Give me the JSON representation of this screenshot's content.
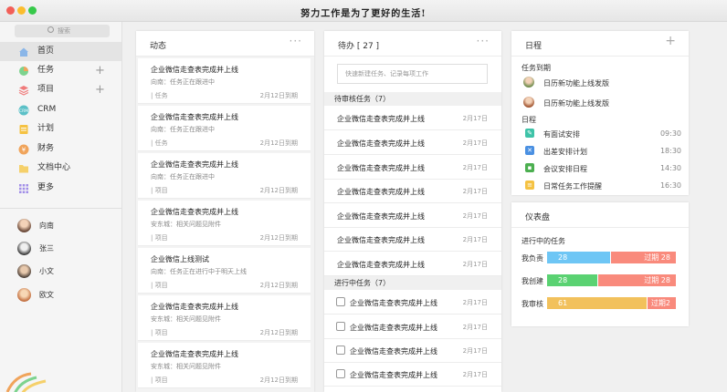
{
  "window": {
    "title": "努力工作是为了更好的生活!"
  },
  "search": {
    "placeholder": "搜索"
  },
  "sidebar": {
    "nav": [
      {
        "label": "首页",
        "icon": "home-icon"
      },
      {
        "label": "任务",
        "icon": "task-icon"
      },
      {
        "label": "项目",
        "icon": "project-icon"
      },
      {
        "label": "CRM",
        "icon": "crm-icon"
      },
      {
        "label": "计划",
        "icon": "plan-icon"
      },
      {
        "label": "财务",
        "icon": "finance-icon"
      },
      {
        "label": "文档中心",
        "icon": "document-icon"
      },
      {
        "label": "更多",
        "icon": "more-grid-icon"
      }
    ],
    "people": [
      "向南",
      "张三",
      "小文",
      "欧文"
    ]
  },
  "feed": {
    "title": "动态",
    "items": [
      {
        "title": "企业微信走查表完成并上线",
        "desc": "向南：任务正在跟进中",
        "tag": "任务",
        "date": "2月12日到期"
      },
      {
        "title": "企业微信走查表完成并上线",
        "desc": "向南：任务正在跟进中",
        "tag": "任务",
        "date": "2月12日到期"
      },
      {
        "title": "企业微信走查表完成并上线",
        "desc": "向南：任务正在跟进中",
        "tag": "项目",
        "date": "2月12日到期"
      },
      {
        "title": "企业微信走查表完成并上线",
        "desc": "安东城：相关问题见附件",
        "tag": "项目",
        "date": "2月12日到期"
      },
      {
        "title": "企业微信上线测试",
        "desc": "向南：任务正在进行中于明天上线",
        "tag": "项目",
        "date": "2月12日到期"
      },
      {
        "title": "企业微信走查表完成并上线",
        "desc": "安东城：相关问题见附件",
        "tag": "项目",
        "date": "2月12日到期"
      },
      {
        "title": "企业微信走查表完成并上线",
        "desc": "安东城：相关问题见附件",
        "tag": "项目",
        "date": "2月12日到期"
      }
    ]
  },
  "todo": {
    "title": "待办 [ 27 ]",
    "quick_placeholder": "快速新建任务、记录每项工作",
    "pending_header": "待审核任务（7）",
    "pending": [
      {
        "title": "企业微信走查表完成并上线",
        "date": "2月17日"
      },
      {
        "title": "企业微信走查表完成并上线",
        "date": "2月17日"
      },
      {
        "title": "企业微信走查表完成并上线",
        "date": "2月17日"
      },
      {
        "title": "企业微信走查表完成并上线",
        "date": "2月17日"
      },
      {
        "title": "企业微信走查表完成并上线",
        "date": "2月17日"
      },
      {
        "title": "企业微信走查表完成并上线",
        "date": "2月17日"
      },
      {
        "title": "企业微信走查表完成并上线",
        "date": "2月17日"
      }
    ],
    "progress_header": "进行中任务（7）",
    "progress": [
      {
        "title": "企业微信走查表完成并上线",
        "date": "2月17日"
      },
      {
        "title": "企业微信走查表完成并上线",
        "date": "2月17日"
      },
      {
        "title": "企业微信走查表完成并上线",
        "date": "2月17日"
      },
      {
        "title": "企业微信走查表完成并上线",
        "date": "2月17日"
      }
    ]
  },
  "schedule": {
    "title": "日程",
    "due_label": "任务到期",
    "due": [
      {
        "title": "日历新功能上线发版"
      },
      {
        "title": "日历新功能上线发版"
      }
    ],
    "cal_label": "日程",
    "events": [
      {
        "title": "有面试安排",
        "time": "09:30",
        "icon": "interview-icon",
        "color": "#3ec3a8"
      },
      {
        "title": "出差安排计划",
        "time": "18:30",
        "icon": "travel-icon",
        "color": "#4a90e2"
      },
      {
        "title": "会议安排日程",
        "time": "14:30",
        "icon": "meeting-icon",
        "color": "#4caf50"
      },
      {
        "title": "日常任务工作提醒",
        "time": "16:30",
        "icon": "reminder-icon",
        "color": "#f5c242"
      }
    ]
  },
  "dashboard": {
    "title": "仪表盘",
    "subtitle": "进行中的任务",
    "rows": [
      {
        "label": "我负责",
        "value": "28",
        "over_label": "过期 28",
        "fraction": 0.49,
        "color": "#6ec6f5",
        "over_color": "#f98a7c"
      },
      {
        "label": "我创建",
        "value": "28",
        "over_label": "过期 28",
        "fraction": 0.39,
        "color": "#5ad272",
        "over_color": "#f98a7c"
      },
      {
        "label": "我审核",
        "value": "61",
        "over_label": "过期2",
        "fraction": 0.77,
        "color": "#f2c15c",
        "over_color": "#f98a7c"
      }
    ]
  }
}
